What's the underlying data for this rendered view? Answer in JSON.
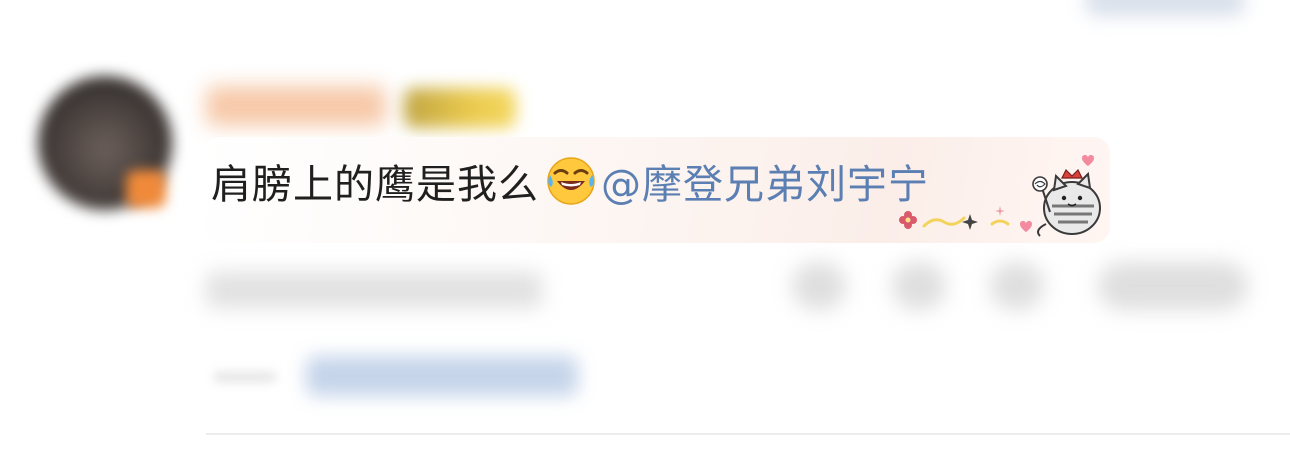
{
  "comment": {
    "text": "肩膀上的鹰是我么",
    "emoji": "laughing-with-tears-icon",
    "mention": "@摩登兄弟刘宇宁"
  },
  "colors": {
    "mention": "#5b7fb2",
    "text": "#1f1f1f",
    "bubble_tint": "#fbeee9"
  },
  "decorations": {
    "sticker": "cat-sticker-icon"
  }
}
